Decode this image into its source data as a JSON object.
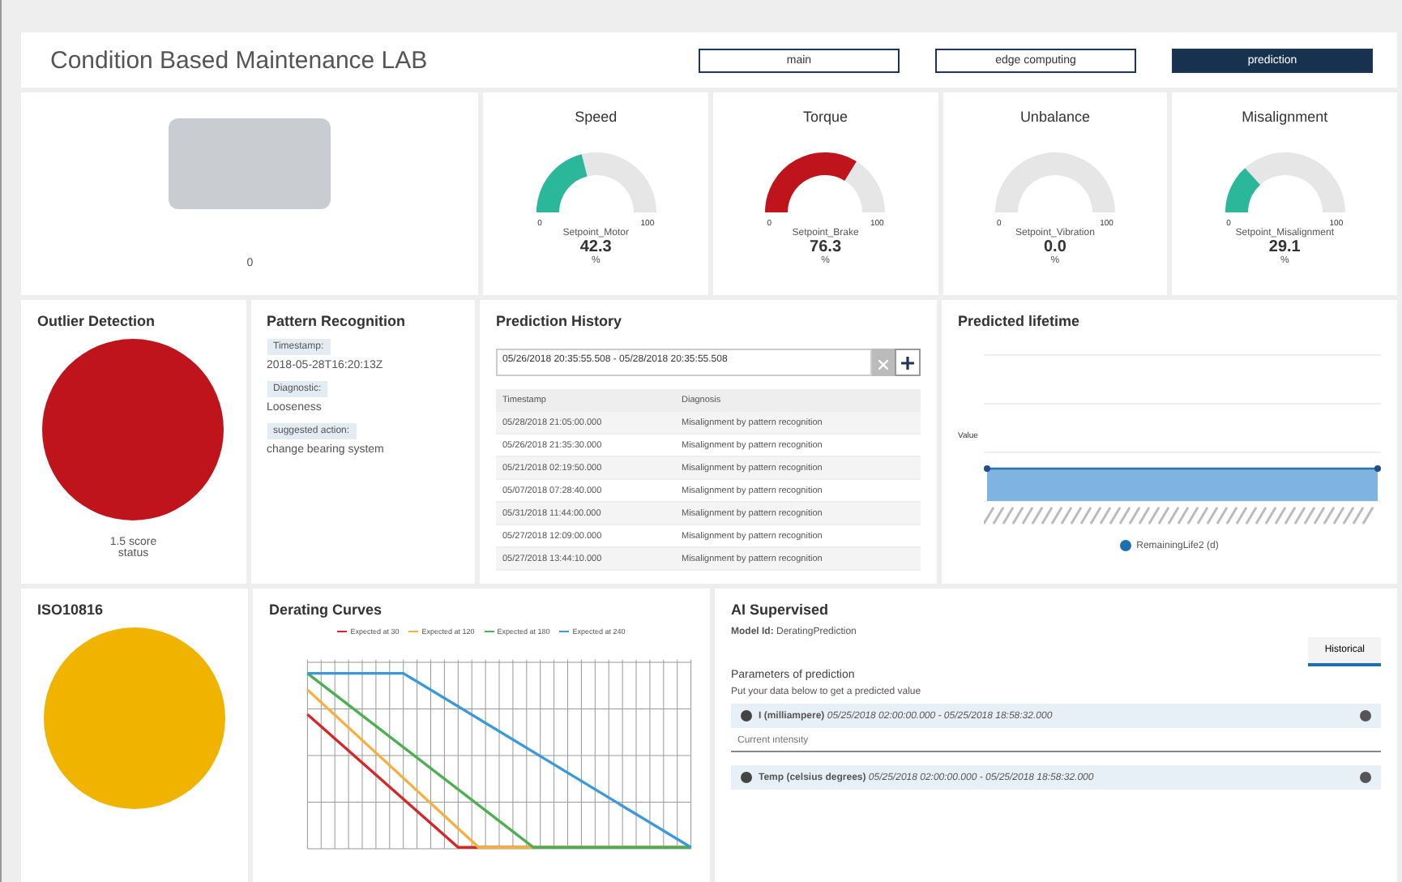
{
  "header": {
    "title": "Condition Based Maintenance LAB",
    "tabs": [
      {
        "label": "main",
        "selected": false
      },
      {
        "label": "edge computing",
        "selected": false
      },
      {
        "label": "prediction",
        "selected": true
      }
    ]
  },
  "machine": {
    "caption": "0"
  },
  "gauges": [
    {
      "title": "Speed",
      "min": "0",
      "max": "100",
      "setpoint": "Setpoint_Motor",
      "value": "42.3",
      "unit": "%",
      "level": 0.423,
      "color": "#2bb89a"
    },
    {
      "title": "Torque",
      "min": "0",
      "max": "100",
      "setpoint": "Setpoint_Brake",
      "value": "76.3",
      "unit": "%",
      "level": 0.763,
      "color": "#c0141c"
    },
    {
      "title": "Unbalance",
      "min": "0",
      "max": "100",
      "setpoint": "Setpoint_Vibration",
      "value": "0.0",
      "unit": "%",
      "level": 0
    },
    {
      "title": "Misalignment",
      "min": "0",
      "max": "100",
      "setpoint": "Setpoint_Misalignment",
      "value": "29.1",
      "unit": "%",
      "level": 0.291,
      "color": "#2bb89a"
    }
  ],
  "outlier": {
    "title": "Outlier Detection",
    "color": "#c0141c",
    "score": "1.5 score",
    "status": "status"
  },
  "pattern": {
    "title": "Pattern Recognition",
    "fields": [
      {
        "label": "Timestamp:",
        "value": "2018-05-28T16:20:13Z"
      },
      {
        "label": "Diagnostic:",
        "value": "Looseness"
      },
      {
        "label": "suggested action:",
        "value": "change bearing system"
      }
    ]
  },
  "history": {
    "title": "Prediction History",
    "range": "05/26/2018 20:35:55.508 - 05/28/2018 20:35:55.508",
    "columns": [
      "Timestamp",
      "Diagnosis"
    ],
    "rows": [
      [
        "05/28/2018 21:05:00.000",
        "Misalignment by pattern recognition"
      ],
      [
        "05/26/2018 21:35:30.000",
        "Misalignment by pattern recognition"
      ],
      [
        "05/21/2018 02:19:50.000",
        "Misalignment by pattern recognition"
      ],
      [
        "05/07/2018 07:28:40.000",
        "Misalignment by pattern recognition"
      ],
      [
        "05/31/2018 11:44:00.000",
        "Misalignment by pattern recognition"
      ],
      [
        "05/27/2018 12:09:00.000",
        "Misalignment by pattern recognition"
      ],
      [
        "05/27/2018 13:44:10.000",
        "Misalignment by pattern recognition"
      ]
    ]
  },
  "lifetime": {
    "title": "Predicted lifetime",
    "ylabel": "Value",
    "legend": "RemainingLife2 (d)"
  },
  "iso": {
    "title": "ISO10816",
    "color": "#f0b400"
  },
  "derating": {
    "title": "Derating Curves",
    "legend": [
      {
        "label": "Expected at 30",
        "color": "#d62728"
      },
      {
        "label": "Expected at 120",
        "color": "#f5b041"
      },
      {
        "label": "Expected at 180",
        "color": "#4caf50"
      },
      {
        "label": "Expected at 240",
        "color": "#3a9ad9"
      }
    ]
  },
  "ai": {
    "title": "AI Supervised",
    "model": "**Model Id:** DeratingPrediction",
    "tabs": [
      {
        "label": "Historical",
        "selected": true
      }
    ],
    "section": "Parameters of prediction",
    "hint": "Put your data below to get a predicted value",
    "params": [
      {
        "label": "**I (milliampere)** *05/25/2018 02:00:00.000 - 05/25/2018 18:58:32.000*",
        "placeholder": "Current intensity"
      },
      {
        "label": "**Temp (celsius degrees)** *05/25/2018 02:00:00.000 - 05/25/2018 18:58:32.000*"
      }
    ]
  }
}
